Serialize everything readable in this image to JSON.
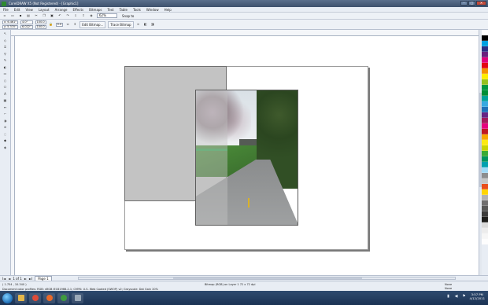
{
  "window": {
    "title": "CorelDRAW X5 (Not Registered) - [Graphic1]",
    "controls": {
      "minimize": "–",
      "maximize": "□",
      "close": "✕"
    }
  },
  "menu": [
    "File",
    "Edit",
    "View",
    "Layout",
    "Arrange",
    "Effects",
    "Bitmaps",
    "Text",
    "Table",
    "Tools",
    "Window",
    "Help"
  ],
  "toolbar": {
    "zoom": "62%",
    "snap_label": "Snap to",
    "icons": [
      "new-icon",
      "open-icon",
      "save-icon",
      "print-icon",
      "cut-icon",
      "copy-icon",
      "paste-icon",
      "undo-icon",
      "redo-icon",
      "import-icon",
      "export-icon",
      "launcher-icon"
    ]
  },
  "propbar": {
    "x": "x: 6.461\"",
    "y": "y: 5.370\"",
    "w": "4.0\"",
    "h": "6.022\"",
    "scale_w": "100.0",
    "scale_h": "100.0",
    "angle": "0.0",
    "edit_bitmap": "Edit Bitmap...",
    "trace_bitmap": "Trace Bitmap"
  },
  "toolbox": [
    "pick-tool",
    "shape-tool",
    "crop-tool",
    "zoom-tool",
    "freehand-tool",
    "smart-fill-tool",
    "rectangle-tool",
    "ellipse-tool",
    "polygon-tool",
    "text-tool",
    "table-tool",
    "dimension-tool",
    "connector-tool",
    "blend-tool",
    "eyedropper-tool",
    "outline-tool",
    "fill-tool",
    "interactive-fill-tool"
  ],
  "palette": [
    "#ffffff",
    "#000000",
    "#00a0e0",
    "#2c2e83",
    "#6a1f7c",
    "#e0007a",
    "#e30613",
    "#f39200",
    "#ffed00",
    "#95c11f",
    "#009640",
    "#008d36",
    "#00a19a",
    "#36a9e1",
    "#1d71b8",
    "#662483",
    "#a3195b",
    "#e6007e",
    "#be1622",
    "#f7a600",
    "#fcea10",
    "#c8d400",
    "#3aaa35",
    "#00935f",
    "#00a0af",
    "#9fd9f6",
    "#8c8d8e",
    "#c6c6c5",
    "#e94e1b",
    "#ffd500",
    "#b2b2b2",
    "#706f6f",
    "#575756",
    "#3c3c3b",
    "#1d1d1b",
    "#dadada",
    "#ececec",
    "#f6f6f6",
    "#fdfdfd"
  ],
  "pagenav": {
    "first": "I◄",
    "prev": "◄",
    "counter": "1 of 1",
    "next": "►",
    "last": "►I",
    "page_tab": "Page 1"
  },
  "status": {
    "coords": "( 1.754 , 10.340 )",
    "document_info": "Document color profiles: RGB: sRGB IEC61966-2.1; CMYK: U.S. Web Coated (SWOP) v2; Grayscale: Dot Gain 20%",
    "selection": "Bitmap (RGB) on Layer 1 72 x 72 dpi",
    "fill": "None",
    "outline": "None"
  },
  "taskbar": {
    "apps": [
      {
        "name": "explorer",
        "color": "#e4b64a"
      },
      {
        "name": "chrome",
        "color": "#dd4b39"
      },
      {
        "name": "firefox",
        "color": "#e8692a"
      },
      {
        "name": "coreldraw",
        "color": "#3f9b3f"
      },
      {
        "name": "media",
        "color": "#9aa9b8"
      }
    ],
    "time": "3:57 PM",
    "date": "4/12/2011"
  }
}
